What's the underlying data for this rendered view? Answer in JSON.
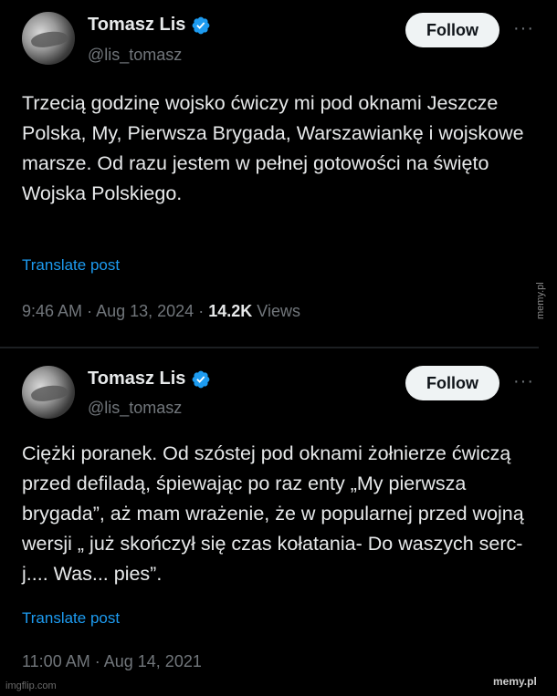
{
  "tweets": [
    {
      "author_name": "Tomasz Lis",
      "handle": "@lis_tomasz",
      "follow_label": "Follow",
      "more_label": "···",
      "text": "Trzecią godzinę wojsko ćwiczy mi pod oknami Jeszcze Polska, My, Pierwsza Brygada, Warszawiankę i wojskowe marsze. Od razu jestem w pełnej gotowości na święto Wojska Polskiego.",
      "translate_label": "Translate post",
      "time": "9:46 AM",
      "date": "Aug 13, 2024",
      "views_count": "14.2K",
      "views_label": "Views"
    },
    {
      "author_name": "Tomasz Lis",
      "handle": "@lis_tomasz",
      "follow_label": "Follow",
      "more_label": "···",
      "text": "Ciężki poranek. Od szóstej pod oknami żołnierze ćwiczą przed defiladą, śpiewając po raz enty „My pierwsza brygada”, aż mam wrażenie, że w popularnej przed wojną wersji „ już skończył  się czas kołatania- Do waszych serc- j.... Was... pies”.",
      "translate_label": "Translate post",
      "time": "11:00 AM",
      "date": "Aug 14, 2021"
    }
  ],
  "separator": "·",
  "watermarks": {
    "vertical": "memy.pl",
    "imgflip": "imgflip.com",
    "memy": "memy.pl"
  },
  "colors": {
    "background": "#000000",
    "text": "#e7e9ea",
    "secondary": "#71767b",
    "link": "#1d9bf0",
    "verified": "#1d9bf0",
    "follow_bg": "#eff3f4"
  },
  "icons": [
    "verified-badge-icon",
    "more-options-icon"
  ]
}
